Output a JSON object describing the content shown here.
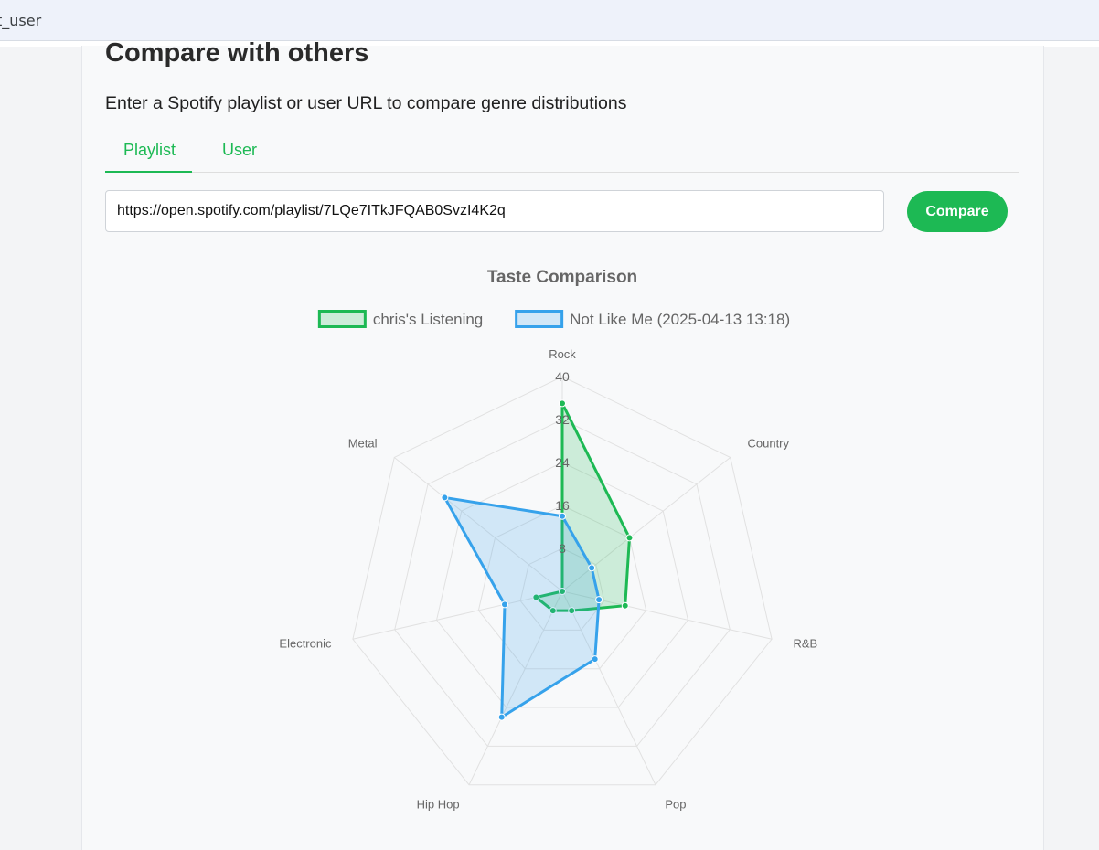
{
  "browser": {
    "address_text": "t_user"
  },
  "page": {
    "title": "Compare with others",
    "subtitle": "Enter a Spotify playlist or user URL to compare genre distributions"
  },
  "tabs": [
    {
      "label": "Playlist",
      "active": true
    },
    {
      "label": "User",
      "active": false
    }
  ],
  "url_input": {
    "value": "https://open.spotify.com/playlist/7LQe7ITkJFQAB0SvzI4K2q",
    "placeholder": ""
  },
  "compare_button": {
    "label": "Compare"
  },
  "colors": {
    "accent": "#1db954",
    "series_1": "#1db954",
    "series_2": "#36a2eb"
  },
  "chart_data": {
    "type": "radar",
    "title": "Taste Comparison",
    "categories": [
      "Rock",
      "Country",
      "R&B",
      "Pop",
      "Hip Hop",
      "Electronic",
      "Metal"
    ],
    "r_ticks": [
      "8",
      "16",
      "24",
      "32",
      "40"
    ],
    "r_range": [
      0,
      40
    ],
    "legend_position": "top",
    "grid": true,
    "series": [
      {
        "name": "chris's Listening",
        "color": "#1db954",
        "values": [
          35,
          16,
          12,
          4,
          4,
          5,
          0
        ]
      },
      {
        "name": "Not Like Me (2025-04-13 13:18)",
        "color": "#36a2eb",
        "values": [
          14,
          7,
          7,
          14,
          26,
          11,
          28
        ]
      }
    ]
  }
}
